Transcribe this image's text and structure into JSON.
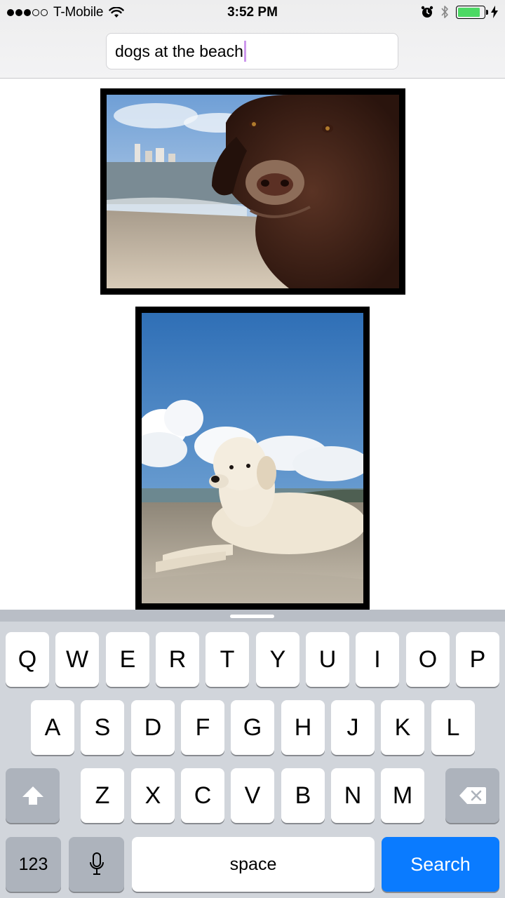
{
  "status_bar": {
    "carrier": "T-Mobile",
    "signal_bars_filled": 3,
    "signal_bars_total": 5,
    "time": "3:52 PM",
    "battery_level": 0.85,
    "battery_color": "#4cd964",
    "icons": [
      "wifi-icon",
      "alarm-icon",
      "bluetooth-icon",
      "charging-bolt-icon"
    ]
  },
  "search": {
    "query": "dogs at the beach"
  },
  "results": [
    {
      "subject": "dog-face-on-beach-photo"
    },
    {
      "subject": "dog-lying-on-sand-photo"
    }
  ],
  "keyboard": {
    "row1": [
      "Q",
      "W",
      "E",
      "R",
      "T",
      "Y",
      "U",
      "I",
      "O",
      "P"
    ],
    "row2": [
      "A",
      "S",
      "D",
      "F",
      "G",
      "H",
      "J",
      "K",
      "L"
    ],
    "row3": [
      "Z",
      "X",
      "C",
      "V",
      "B",
      "N",
      "M"
    ],
    "numbers_label": "123",
    "space_label": "space",
    "search_label": "Search",
    "accent_color": "#0a7bff"
  }
}
